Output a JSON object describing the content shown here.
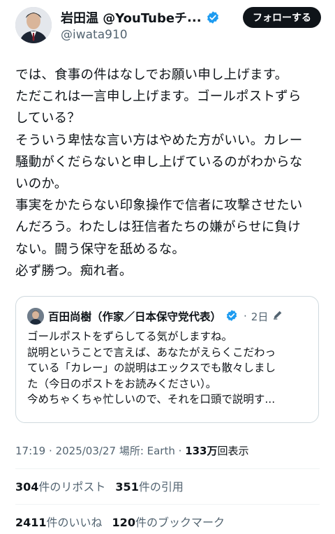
{
  "author": {
    "display_name": "岩田温 @YouTubeチ",
    "ellipsis": "...",
    "handle": "@iwata910",
    "follow_label": "フォローする"
  },
  "tweet": {
    "lines": [
      "では、食事の件はなしでお願い申し上げます。",
      "ただこれは一言申し上げます。ゴールポストずら",
      "している？",
      "そういう卑怯な言い方はやめた方がいい。カレー",
      "騒動がくだらないと申し上げているのがわからな",
      "いのか。",
      "事実をかたらない印象操作で信者に攻撃させたい",
      "んだろう。わたしは狂信者たちの嫌がらせに負け",
      "ない。闘う保守を舐めるな。",
      "必ず勝つ。痴れ者。"
    ]
  },
  "quote": {
    "author_name": "百田尚樹（作家／日本保守党代表）",
    "separator": "·",
    "time": "2日",
    "lines": [
      "ゴールポストをずらしてる気がしますね。",
      "説明ということで言えば、あなたがえらくこだわっ",
      "ている「カレー」の説明はエックスでも散々しまし",
      "た（今日のポストをお読みください）。",
      "今めちゃくちゃ忙しいので、それを口頭で説明す..."
    ]
  },
  "meta": {
    "time": "17:19",
    "date": "2025/03/27",
    "location": "場所: Earth",
    "views_count": "133万",
    "views_label": "回表示"
  },
  "stats": {
    "reposts_count": "304",
    "reposts_label": "件のリポスト",
    "quotes_count": "351",
    "quotes_label": "件の引用",
    "likes_count": "2411",
    "likes_label": "件のいいね",
    "bookmarks_count": "120",
    "bookmarks_label": "件のブックマーク"
  },
  "colors": {
    "verified": "#1d9bf0",
    "text": "#0f1419",
    "secondary": "#536471",
    "border": "#cfd9de",
    "gold_badge": "#e2b719"
  },
  "icons": [
    "verified-badge-icon",
    "pencil-edit-icon"
  ]
}
